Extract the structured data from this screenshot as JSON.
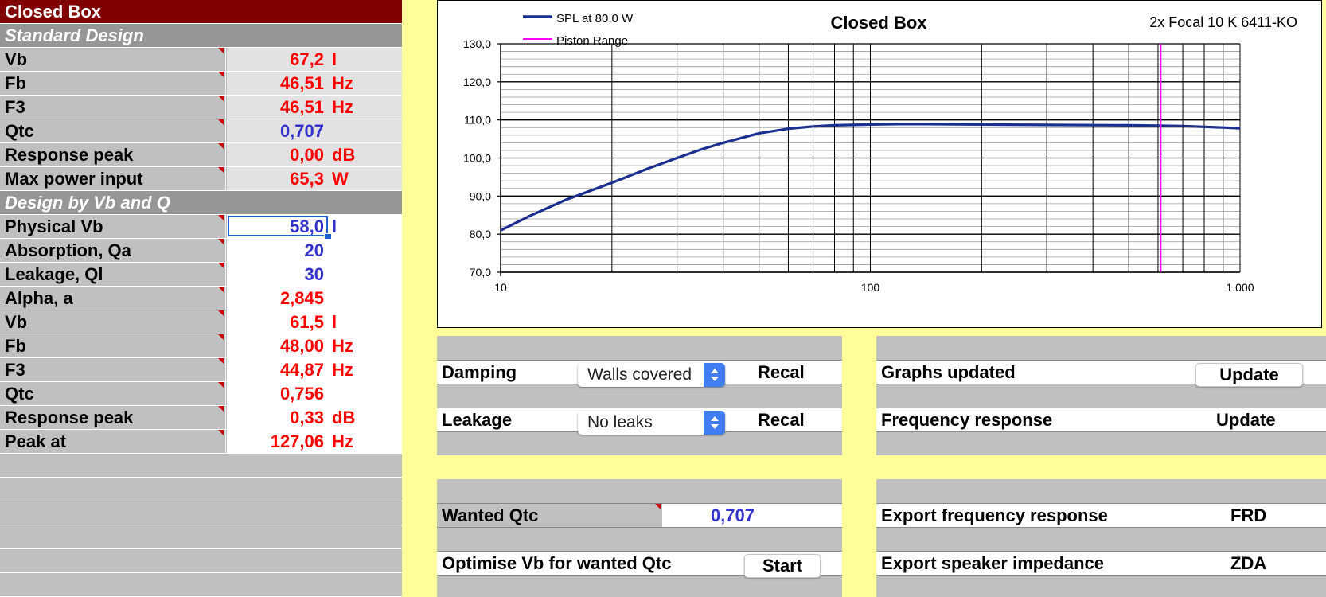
{
  "sheet": {
    "title": "Closed Box",
    "standard_design": {
      "header": "Standard Design",
      "rows": [
        {
          "label": "Vb",
          "value": "67,2",
          "unit": "l",
          "color": "red"
        },
        {
          "label": "Fb",
          "value": "46,51",
          "unit": "Hz",
          "color": "red"
        },
        {
          "label": "F3",
          "value": "46,51",
          "unit": "Hz",
          "color": "red"
        },
        {
          "label": "Qtc",
          "value": "0,707",
          "unit": "",
          "color": "blue"
        },
        {
          "label": "Response peak",
          "value": "0,00",
          "unit": "dB",
          "color": "red"
        },
        {
          "label": "Max power input",
          "value": "65,3",
          "unit": "W",
          "color": "red"
        }
      ]
    },
    "design_by_vb_q": {
      "header": "Design by Vb and Q",
      "rows": [
        {
          "label": "Physical Vb",
          "value": "58,0",
          "unit": "l",
          "color": "blue"
        },
        {
          "label": "Absorption, Qa",
          "value": "20",
          "unit": "",
          "color": "blue"
        },
        {
          "label": "Leakage, Ql",
          "value": "30",
          "unit": "",
          "color": "blue"
        },
        {
          "label": "Alpha, a",
          "value": "2,845",
          "unit": "",
          "color": "red"
        },
        {
          "label": "Vb",
          "value": "61,5",
          "unit": "l",
          "color": "red"
        },
        {
          "label": "Fb",
          "value": "48,00",
          "unit": "Hz",
          "color": "red"
        },
        {
          "label": "F3",
          "value": "44,87",
          "unit": "Hz",
          "color": "red"
        },
        {
          "label": "Qtc",
          "value": "0,756",
          "unit": "",
          "color": "red"
        },
        {
          "label": "Response peak",
          "value": "0,33",
          "unit": "dB",
          "color": "red"
        },
        {
          "label": "Peak at",
          "value": "127,06",
          "unit": "Hz",
          "color": "red"
        }
      ]
    }
  },
  "chart_data": {
    "type": "line",
    "title": "Closed Box",
    "subtitle": "2x Focal 10 K 6411-KO",
    "xscale": "log",
    "xlim": [
      10,
      1000
    ],
    "ylim": [
      70,
      130
    ],
    "x_tick_labels": [
      "10",
      "100",
      "1.000"
    ],
    "y_tick_labels": [
      "130,0",
      "120,0",
      "110,0",
      "100,0",
      "90,0",
      "80,0",
      "70,0"
    ],
    "legend_placement": "top-left",
    "grid": true,
    "series": [
      {
        "name": "SPL at 80,0 W",
        "color": "#1a2f8f",
        "x": [
          10,
          12,
          15,
          20,
          25,
          30,
          35,
          40,
          45,
          50,
          60,
          70,
          80,
          100,
          120,
          140,
          200,
          300,
          500,
          600,
          700,
          800,
          900,
          1000
        ],
        "y": [
          81.0,
          84.8,
          89.0,
          93.5,
          97.2,
          100.0,
          102.3,
          104.0,
          105.3,
          106.5,
          107.7,
          108.3,
          108.6,
          108.8,
          108.9,
          108.9,
          108.8,
          108.7,
          108.6,
          108.5,
          108.4,
          108.2,
          108.0,
          107.8
        ]
      },
      {
        "name": "Piston Range",
        "color": "#ff00ff",
        "x": [
          610,
          610
        ],
        "y": [
          70,
          130
        ]
      }
    ]
  },
  "controls": {
    "damping_label": "Damping",
    "damping_select": "Walls covered",
    "damping_btn": "Recal",
    "leakage_label": "Leakage",
    "leakage_select": "No leaks",
    "leakage_btn": "Recal",
    "graphs_label": "Graphs updated",
    "graphs_btn": "Update",
    "freq_label": "Frequency response",
    "freq_btn": "Update",
    "wanted_qtc_label": "Wanted Qtc",
    "wanted_qtc_value": "0,707",
    "optimise_label": "Optimise Vb for wanted Qtc",
    "optimise_btn": "Start",
    "export_freq_label": "Export frequency response",
    "export_freq_btn": "FRD",
    "export_imp_label": "Export speaker impedance",
    "export_imp_btn": "ZDA"
  },
  "colors": {
    "title_bg": "#800000",
    "section_bg": "#969696",
    "cell_bg": "#c0c0c0",
    "value_red": "#ff0000",
    "value_blue": "#3333cc",
    "page_bg": "#ffff99"
  }
}
